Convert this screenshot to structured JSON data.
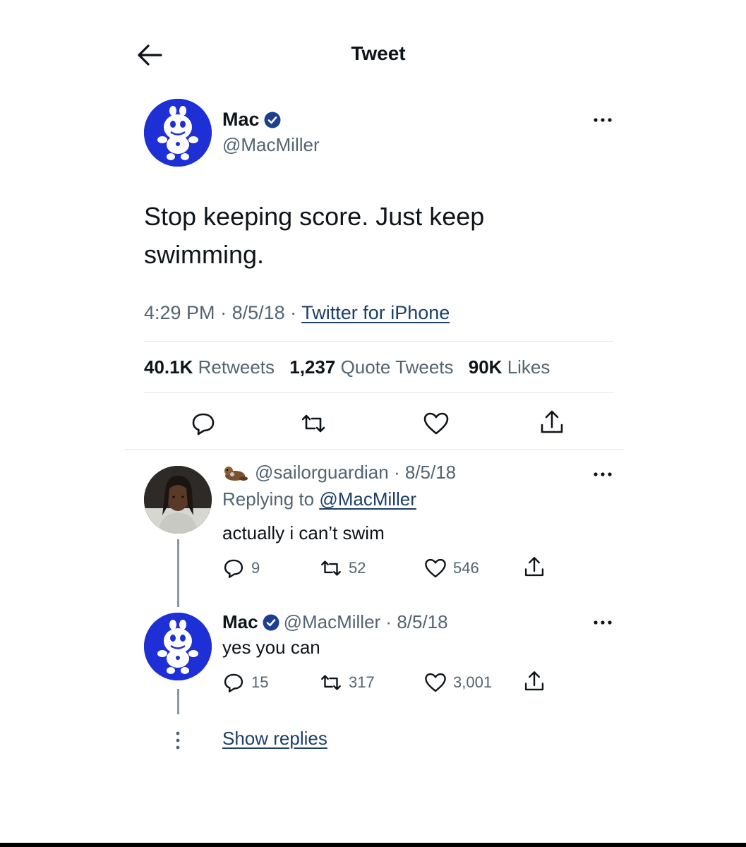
{
  "header": {
    "title": "Tweet",
    "back_icon": "arrow-left-icon"
  },
  "main_tweet": {
    "author_name": "Mac",
    "author_handle": "@MacMiller",
    "verified": true,
    "text": "Stop keeping score. Just keep swimming.",
    "time": "4:29 PM",
    "date": "8/5/18",
    "source": "Twitter for iPhone",
    "stats": {
      "retweets_count": "40.1K",
      "retweets_label": "Retweets",
      "quotes_count": "1,237",
      "quotes_label": "Quote Tweets",
      "likes_count": "90K",
      "likes_label": "Likes"
    }
  },
  "replies": [
    {
      "handle": "@sailorguardian",
      "date": "8/5/18",
      "replying_prefix": "Replying to",
      "replying_to": "@MacMiller",
      "text": "actually i can’t swim",
      "reply_count": "9",
      "retweet_count": "52",
      "like_count": "546"
    },
    {
      "author_name": "Mac",
      "handle": "@MacMiller",
      "date": "8/5/18",
      "text": "yes you can",
      "reply_count": "15",
      "retweet_count": "317",
      "like_count": "3,001"
    }
  ],
  "show_replies_label": "Show replies",
  "colors": {
    "verified_blue": "#1d9bf0",
    "avatar_blue": "#1f2fd6",
    "link": "#1d3f66",
    "muted": "#536471"
  }
}
